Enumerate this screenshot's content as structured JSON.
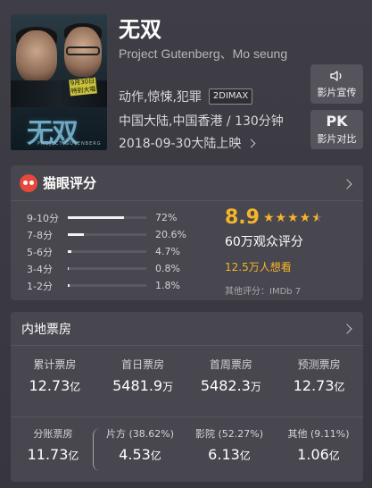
{
  "movie": {
    "title": "无双",
    "subtitle": "Project Gutenberg、Mo seung",
    "genres": "动作,惊悚,犯罪",
    "format_badge": "2DIMAX",
    "region_duration": "中国大陆,中国香港 / 130分钟",
    "release": "2018-09-30大陆上映",
    "poster": {
      "date_text": "9月30日",
      "date_sub": "特别大喵",
      "title_art": "无双",
      "eng_text": "PROJECT GUTENBERG"
    }
  },
  "side_buttons": {
    "promo_label": "影片宣传",
    "pk_glyph": "PK",
    "pk_label": "影片对比"
  },
  "rating": {
    "title": "猫眼评分",
    "score": "8.9",
    "stars": 4.5,
    "viewers": "60万观众评分",
    "wish": "12.5万人想看",
    "other": "其他评分：IMDb 7",
    "distribution": [
      {
        "label": "9-10分",
        "pct_text": "72%",
        "pct": 72
      },
      {
        "label": "7-8分",
        "pct_text": "20.6%",
        "pct": 20.6
      },
      {
        "label": "5-6分",
        "pct_text": "4.7%",
        "pct": 4.7
      },
      {
        "label": "3-4分",
        "pct_text": "0.8%",
        "pct": 0.8
      },
      {
        "label": "1-2分",
        "pct_text": "1.8%",
        "pct": 1.8
      }
    ],
    "colors": {
      "accent": "#f5b52a",
      "logo": "#e8473b"
    }
  },
  "box_office": {
    "title": "内地票房",
    "stats": [
      {
        "label": "累计票房",
        "value": "12.73",
        "unit": "亿"
      },
      {
        "label": "首日票房",
        "value": "5481.9",
        "unit": "万"
      },
      {
        "label": "首周票房",
        "value": "5482.3",
        "unit": "万"
      },
      {
        "label": "预测票房",
        "value": "12.73",
        "unit": "亿"
      }
    ],
    "split": [
      {
        "label": "分账票房",
        "value": "11.73",
        "unit": "亿"
      },
      {
        "label": "片方 (38.62%)",
        "value": "4.53",
        "unit": "亿"
      },
      {
        "label": "影院 (52.27%)",
        "value": "6.13",
        "unit": "亿"
      },
      {
        "label": "其他 (9.11%)",
        "value": "1.06",
        "unit": "亿"
      }
    ]
  }
}
